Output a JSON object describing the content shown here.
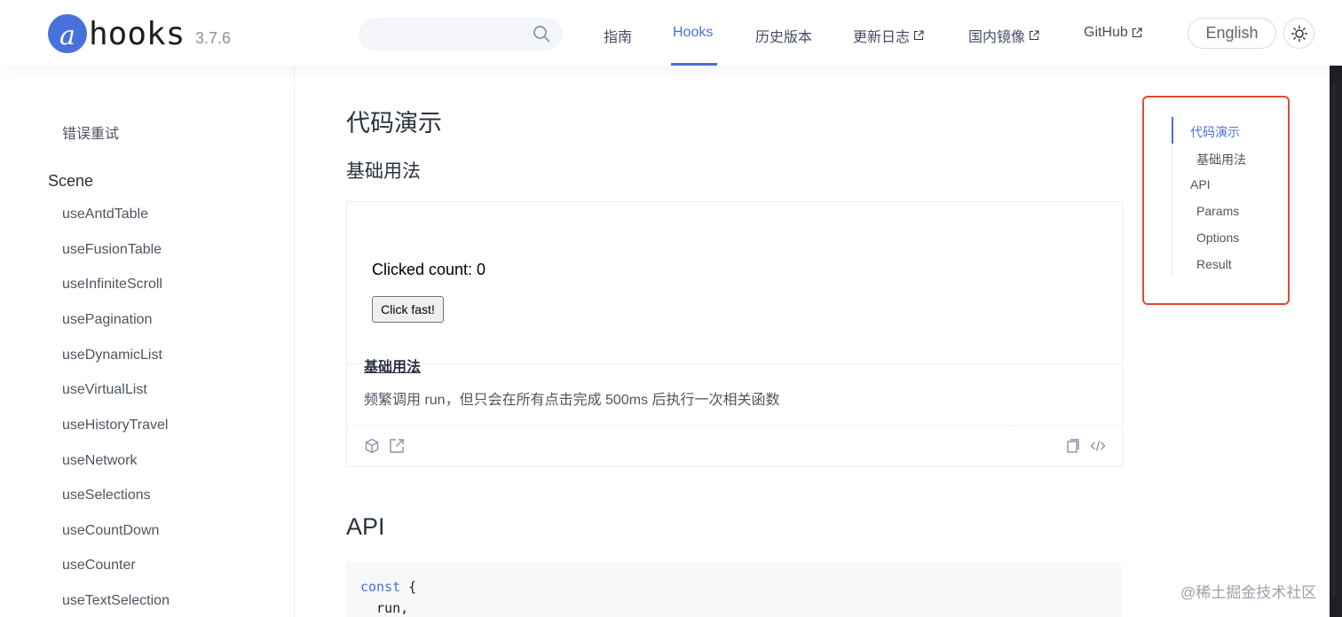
{
  "header": {
    "logo_letter": "a",
    "logo_text": "hooks",
    "version": "3.7.6",
    "search_placeholder": "",
    "nav": [
      {
        "label": "指南",
        "external": false
      },
      {
        "label": "Hooks",
        "external": false,
        "active": true
      },
      {
        "label": "历史版本",
        "external": false
      },
      {
        "label": "更新日志",
        "external": true
      },
      {
        "label": "国内镜像",
        "external": true
      },
      {
        "label": "GitHub",
        "external": true
      }
    ],
    "language_button": "English",
    "icons": {
      "search": "search-icon",
      "theme": "sun-icon",
      "external": "external-link-icon"
    }
  },
  "sidebar": {
    "top_item": "错误重试",
    "group_label": "Scene",
    "items": [
      "useAntdTable",
      "useFusionTable",
      "useInfiniteScroll",
      "usePagination",
      "useDynamicList",
      "useVirtualList",
      "useHistoryTravel",
      "useNetwork",
      "useSelections",
      "useCountDown",
      "useCounter",
      "useTextSelection"
    ]
  },
  "main": {
    "title": "代码演示",
    "subtitle": "基础用法",
    "demo": {
      "count_text": "Clicked count: 0",
      "button_label": "Click fast!",
      "title": "基础用法",
      "description": "频繁调用 run，但只会在所有点击完成 500ms 后执行一次相关函数",
      "action_icons": [
        "codesandbox-icon",
        "open-external-icon",
        "copy-icon",
        "code-icon"
      ]
    },
    "api_title": "API",
    "code_lines": [
      {
        "keyword": "const",
        "rest": " {"
      },
      {
        "keyword": "",
        "rest": "  run,"
      }
    ]
  },
  "toc": {
    "items": [
      {
        "label": "代码演示",
        "active": true,
        "level": 1
      },
      {
        "label": "基础用法",
        "active": false,
        "level": 2
      },
      {
        "label": "API",
        "active": false,
        "level": 1
      },
      {
        "label": "Params",
        "active": false,
        "level": 2
      },
      {
        "label": "Options",
        "active": false,
        "level": 2
      },
      {
        "label": "Result",
        "active": false,
        "level": 2
      }
    ],
    "highlight_color": "#e04a34"
  },
  "watermark": "@稀土掘金技术社区",
  "colors": {
    "accent": "#4a6fdb",
    "logo": "#4971dc"
  }
}
